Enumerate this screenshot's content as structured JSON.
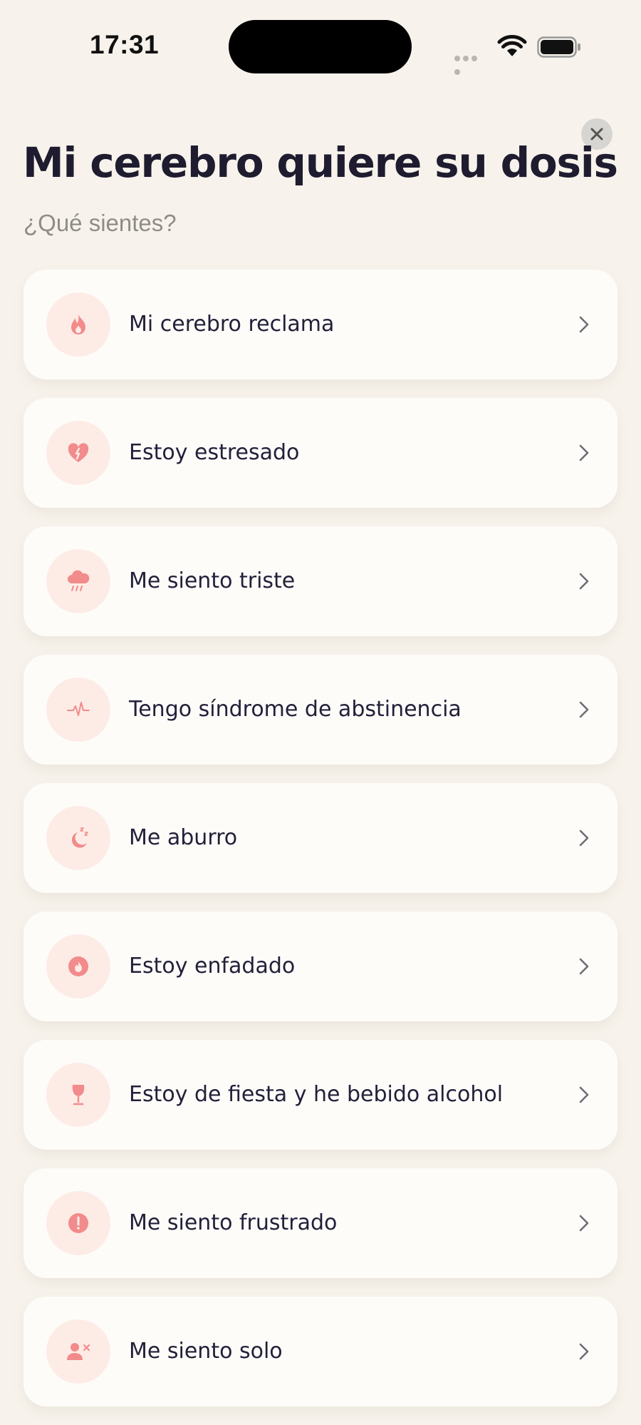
{
  "status_bar": {
    "time": "17:31"
  },
  "header": {
    "title": "Mi cerebro quiere su dosis",
    "subtitle": "¿Qué sientes?"
  },
  "colors": {
    "background": "#f7f3ec",
    "card": "#fefcf9",
    "icon_bg": "#fdece6",
    "icon_fg": "#f28b8b",
    "text": "#23203a"
  },
  "items": [
    {
      "label": "Mi cerebro reclama",
      "icon": "flame-icon"
    },
    {
      "label": "Estoy estresado",
      "icon": "broken-heart-icon"
    },
    {
      "label": "Me siento triste",
      "icon": "rain-cloud-icon"
    },
    {
      "label": "Tengo síndrome de abstinencia",
      "icon": "heartbeat-icon"
    },
    {
      "label": "Me aburro",
      "icon": "moon-sleep-icon"
    },
    {
      "label": "Estoy enfadado",
      "icon": "angry-flame-icon"
    },
    {
      "label": "Estoy de fiesta y he bebido alcohol",
      "icon": "wine-glass-icon"
    },
    {
      "label": "Me siento frustrado",
      "icon": "exclamation-icon"
    },
    {
      "label": "Me siento solo",
      "icon": "person-x-icon"
    }
  ]
}
